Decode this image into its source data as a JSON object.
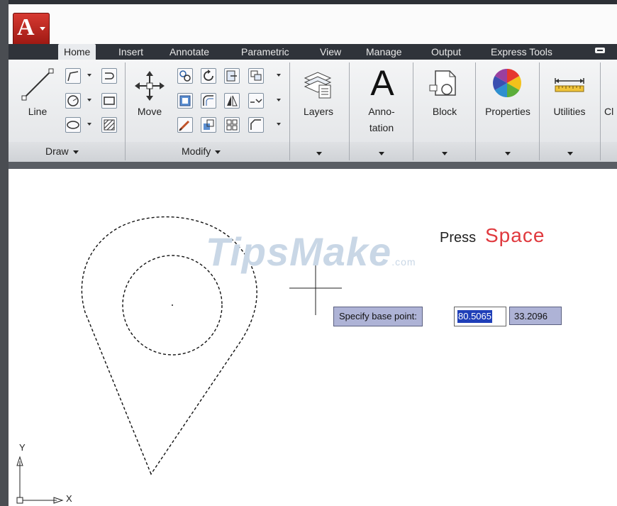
{
  "app": {
    "logo_letter": "A"
  },
  "tabs": [
    "Home",
    "Insert",
    "Annotate",
    "Parametric",
    "View",
    "Manage",
    "Output",
    "Express Tools"
  ],
  "ribbon": {
    "draw_panel": {
      "title": "Draw",
      "line_label": "Line"
    },
    "modify_panel": {
      "title": "Modify",
      "move_label": "Move"
    },
    "layers_label": "Layers",
    "annotation_icon_letter": "A",
    "annotation_label_line1": "Anno-",
    "annotation_label_line2": "tation",
    "block_label": "Block",
    "properties_label": "Properties",
    "utilities_label": "Utilities",
    "clipped_label": "Cl"
  },
  "canvas": {
    "watermark_main": "TipsMake",
    "watermark_suffix": ".com",
    "press_label": "Press",
    "press_key": "Space",
    "prompt": "Specify base point:",
    "coord_x": "80.5065",
    "coord_y": "33.2096",
    "ucs_x_label": "X",
    "ucs_y_label": "Y"
  },
  "colors": {
    "app_button": "#c8261e",
    "press_key": "#e0393e",
    "prompt_bg": "#aeb3d6",
    "selection": "#1f3fb8"
  },
  "icons": [
    "application-menu-icon",
    "line-icon",
    "polyline-icon",
    "arc-icon",
    "circle-icon",
    "rectangle-icon",
    "ellipse-icon",
    "hatch-icon",
    "move-icon",
    "copy-icon",
    "rotate-icon",
    "trim-icon",
    "mirror-icon",
    "fillet-icon",
    "stretch-icon",
    "scale-icon",
    "array-icon",
    "erase-icon",
    "layers-icon",
    "annotation-icon",
    "block-icon",
    "properties-icon",
    "utilities-icon",
    "ucs-icon",
    "crosshair-icon"
  ]
}
